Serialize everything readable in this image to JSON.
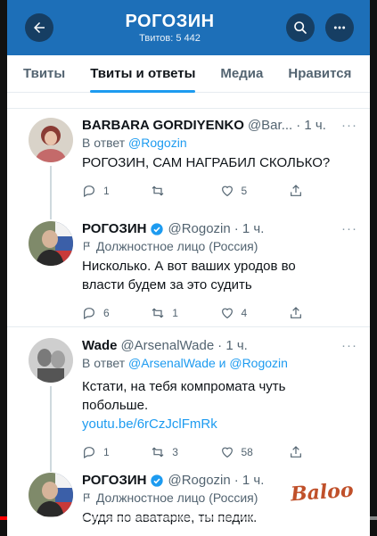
{
  "header": {
    "title": "РОГОЗИН",
    "subtitle": "Твитов: 5 442"
  },
  "tabs": [
    {
      "label": "Твиты"
    },
    {
      "label": "Твиты и ответы",
      "active": true
    },
    {
      "label": "Медиа"
    },
    {
      "label": "Нравится"
    }
  ],
  "tweets": [
    {
      "name": "BARBARA GORDIYENKO",
      "handle": "@Bar...",
      "time": "· 1 ч.",
      "reply_prefix": "В ответ",
      "reply_to": "@Rogozin",
      "text": "РОГОЗИН, САМ НАГРАБИЛ СКОЛЬКО?",
      "replies": "1",
      "retweets": "",
      "likes": "5"
    },
    {
      "name": "РОГОЗИН",
      "handle": "@Rogozin",
      "time": "· 1 ч.",
      "label": "Должностное лицо (Россия)",
      "text_line1": "Нисколько. А вот ваших уродов во",
      "text_line2": "власти будем за это судить",
      "replies": "6",
      "retweets": "1",
      "likes": "4"
    },
    {
      "name": "Wade",
      "handle": "@ArsenalWade",
      "time": "· 1 ч.",
      "reply_prefix": "В ответ",
      "reply_to": "@ArsenalWade и @Rogozin",
      "text_line1": "Кстати, на тебя компромата чуть",
      "text_line2": "побольше.",
      "link": "youtu.be/6rCzJclFmRk",
      "replies": "1",
      "retweets": "3",
      "likes": "58"
    },
    {
      "name": "РОГОЗИН",
      "handle": "@Rogozin",
      "time": "· 1 ч.",
      "label": "Должностное лицо (Россия)",
      "text": "Судя по аватарке, ты педик."
    }
  ],
  "watermark": "Baloo",
  "video_progress": 0.02,
  "colors": {
    "header_bg": "#1d6fb8",
    "accent": "#1d9bf0",
    "verified": "#1d9bf0",
    "progress": "#ff0000"
  }
}
